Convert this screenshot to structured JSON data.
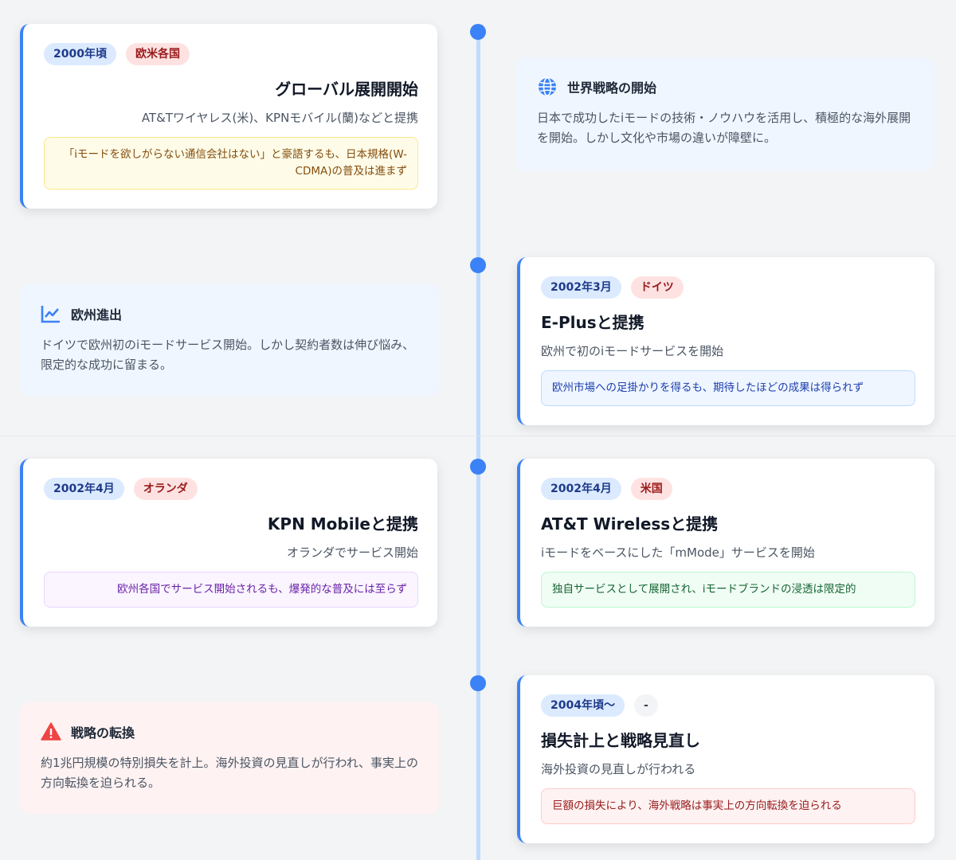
{
  "events": [
    {
      "date": "2000年頃",
      "region": "欧米各国",
      "title": "グローバル展開開始",
      "description": "AT&Tワイヤレス(米)、KPNモバイル(蘭)などと提携",
      "note": "「iモードを欲しがらない通信会社はない」と豪語するも、日本規格(W-CDMA)の普及は進まず"
    },
    {
      "date": "2002年3月",
      "region": "ドイツ",
      "title": "E-Plusと提携",
      "description": "欧州で初のiモードサービスを開始",
      "note": "欧州市場への足掛かりを得るも、期待したほどの成果は得られず"
    },
    {
      "date": "2002年4月",
      "region": "オランダ",
      "title": "KPN Mobileと提携",
      "description": "オランダでサービス開始",
      "note": "欧州各国でサービス開始されるも、爆発的な普及には至らず"
    },
    {
      "date": "2002年4月",
      "region": "米国",
      "title": "AT&T Wirelessと提携",
      "description": "iモードをベースにした「mMode」サービスを開始",
      "note": "独自サービスとして展開され、iモードブランドの浸透は限定的"
    },
    {
      "date": "2004年頃〜",
      "region": "-",
      "title": "損失計上と戦略見直し",
      "description": "海外投資の見直しが行われる",
      "note": "巨額の損失により、海外戦略は事実上の方向転換を迫られる"
    }
  ],
  "summaries": [
    {
      "icon": "globe-icon",
      "title": "世界戦略の開始",
      "text": "日本で成功したiモードの技術・ノウハウを活用し、積極的な海外展開を開始。しかし文化や市場の違いが障壁に。"
    },
    {
      "icon": "chart-line-icon",
      "title": "欧州進出",
      "text": "ドイツで欧州初のiモードサービス開始。しかし契約者数は伸び悩み、限定的な成功に留まる。"
    },
    {
      "icon": "warning-icon",
      "title": "戦略の転換",
      "text": "約1兆円規模の特別損失を計上。海外投資の見直しが行われ、事実上の方向転換を迫られる。"
    }
  ],
  "colors": {
    "accent": "#3b82f6",
    "timeline": "#bfdbfe",
    "warning": "#ef4444"
  }
}
